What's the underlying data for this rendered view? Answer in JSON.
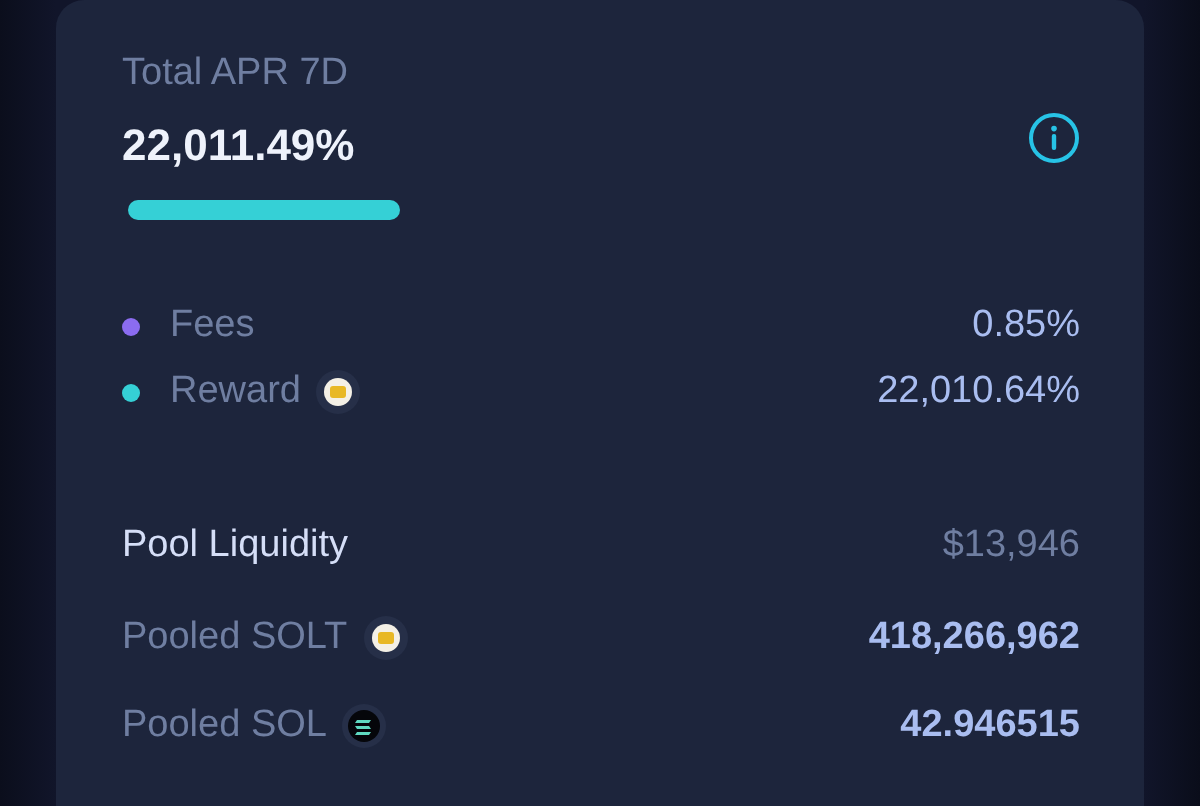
{
  "apr": {
    "label": "Total APR 7D",
    "value": "22,011.49%"
  },
  "breakdown": [
    {
      "label": "Fees",
      "color": "#8b6cf0",
      "kind": "plain",
      "value": "0.85%"
    },
    {
      "label": "Reward",
      "color": "#35d0d6",
      "kind": "coin",
      "value": "22,010.64%"
    }
  ],
  "liquidity": {
    "label": "Pool Liquidity",
    "value": "$13,946"
  },
  "pooled": [
    {
      "label": "Pooled SOLT",
      "kind": "coin",
      "value": "418,266,962"
    },
    {
      "label": "Pooled SOL",
      "kind": "sol",
      "value": "42.946515"
    }
  ]
}
